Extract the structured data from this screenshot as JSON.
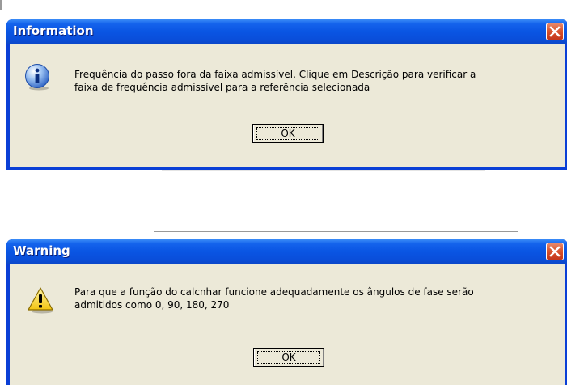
{
  "dialogs": [
    {
      "type": "information",
      "title": "Information",
      "message_lines": [
        "Frequência do passo fora da faixa admissível. Clique em Descrição para verificar a",
        "faixa de frequência admissível para a referência selecionada"
      ],
      "button_label": "OK"
    },
    {
      "type": "warning",
      "title": "Warning",
      "message_lines": [
        "Para que a função do calcnhar funcione adequadamente os ângulos de fase serão",
        "admitidos como 0, 90, 180, 270"
      ],
      "button_label": "OK"
    }
  ],
  "icons": {
    "info": "info-icon",
    "warning": "warning-icon",
    "close": "close-icon"
  },
  "colors": {
    "titlebar": "#0a55e3",
    "client_background": "#ece9d8",
    "close_button": "#d9542f"
  }
}
